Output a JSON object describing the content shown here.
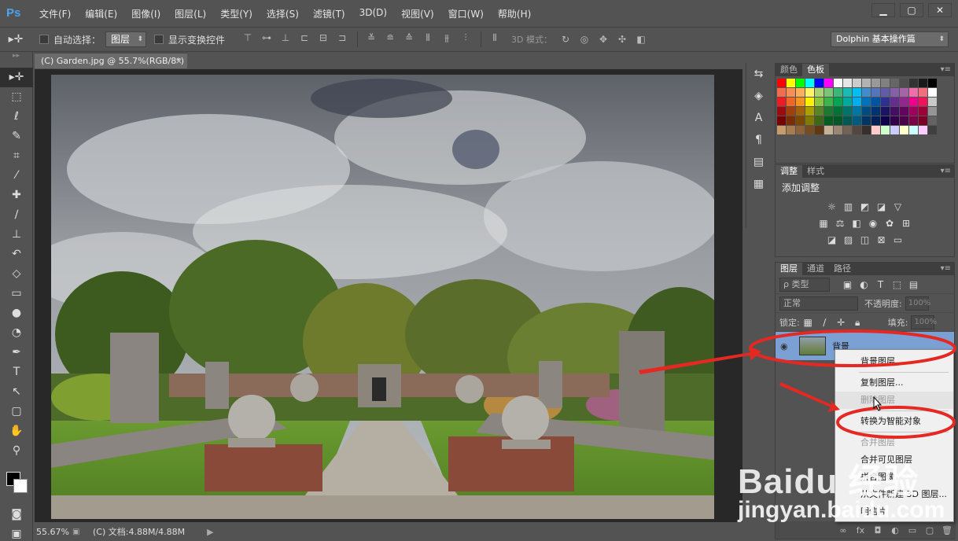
{
  "app": {
    "logo": "Ps"
  },
  "menu": [
    "文件(F)",
    "编辑(E)",
    "图像(I)",
    "图层(L)",
    "类型(Y)",
    "选择(S)",
    "滤镜(T)",
    "3D(D)",
    "视图(V)",
    "窗口(W)",
    "帮助(H)"
  ],
  "window_controls": {
    "minimize": "▁",
    "restore": "▢",
    "close": "✕"
  },
  "options": {
    "auto_select_label": "自动选择：",
    "auto_select_value": "图层",
    "show_transform_label": "显示变换控件",
    "mode3d_label": "3D 模式：",
    "workspace": "Dolphin 基本操作篇"
  },
  "document": {
    "tab_title": "(C) Garden.jpg @ 55.7%(RGB/8*)",
    "tab_close": "×"
  },
  "status": {
    "zoom": "55.67%",
    "doc": "(C) 文档:4.88M/4.88M",
    "arrow": "▶"
  },
  "panels": {
    "color_tabs": [
      "颜色",
      "色板"
    ],
    "adjust_tabs": [
      "调整",
      "样式"
    ],
    "add_adjustment": "添加调整",
    "layers_tabs": [
      "图层",
      "通道",
      "路径"
    ],
    "filter_kind": "ρ 类型",
    "blend_mode": "正常",
    "opacity_label": "不透明度:",
    "opacity_value": "100%",
    "lock_label": "锁定:",
    "fill_label": "填充:",
    "fill_value": "100%",
    "layer_name": "背景",
    "menu_glyph": "▾≡"
  },
  "context_menu": [
    {
      "label": "背景图层...",
      "disabled": false
    },
    {
      "label": "复制图层...",
      "disabled": false
    },
    {
      "label": "删除图层",
      "disabled": true,
      "hover": true
    },
    {
      "label": "转换为智能对象",
      "disabled": false
    },
    {
      "label": "合并图层",
      "disabled": true
    },
    {
      "label": "合并可见图层",
      "disabled": false
    },
    {
      "label": "拼合图像",
      "disabled": false
    },
    {
      "label": "从文件新建 3D 图层...",
      "disabled": false
    },
    {
      "label": "明信片",
      "disabled": false
    }
  ],
  "watermark": {
    "brand": "Baidu 经验",
    "url": "jingyan.baidu.com"
  },
  "colors": {
    "accent_red": "#e52822",
    "selection_blue": "#7aa0d4",
    "ps_blue": "#4aa3f0"
  },
  "swatches": [
    "#ff0000",
    "#ffff00",
    "#00ff00",
    "#00ffff",
    "#0000ff",
    "#ff00ff",
    "#ffffff",
    "#e6e6e6",
    "#cccccc",
    "#b3b3b3",
    "#999999",
    "#808080",
    "#666666",
    "#4d4d4d",
    "#333333",
    "#1a1a1a",
    "#000000",
    "#f26c4f",
    "#f68e55",
    "#fbaf5c",
    "#fff467",
    "#acd372",
    "#7cc576",
    "#3bb878",
    "#1abbb4",
    "#00bff3",
    "#438ccb",
    "#5574b9",
    "#605ca8",
    "#855fa8",
    "#a763a8",
    "#f06ea9",
    "#f26d7d",
    "#ffffff",
    "#ed1c24",
    "#f26522",
    "#f7941d",
    "#fff200",
    "#8dc63f",
    "#39b54a",
    "#00a651",
    "#00a99d",
    "#00aeef",
    "#0072bc",
    "#0054a6",
    "#2e3192",
    "#662d91",
    "#92278f",
    "#ec008c",
    "#ed145b",
    "#c8c8c8",
    "#9e0b0f",
    "#a0410d",
    "#a36209",
    "#aba000",
    "#598527",
    "#1a7b30",
    "#007236",
    "#00746b",
    "#0076a3",
    "#004b80",
    "#003471",
    "#1b1464",
    "#440e62",
    "#630460",
    "#9e005d",
    "#9e0039",
    "#959595",
    "#790000",
    "#7b2e00",
    "#7d4900",
    "#827b00",
    "#406618",
    "#005e20",
    "#005826",
    "#005952",
    "#005b7f",
    "#003663",
    "#002157",
    "#0d004c",
    "#32004b",
    "#4b0049",
    "#7b0046",
    "#7a0026",
    "#636363",
    "#c69c6d",
    "#a67c52",
    "#8c6239",
    "#754c24",
    "#603813",
    "#c7b299",
    "#998675",
    "#736357",
    "#534741",
    "#362f2d",
    "#ffcccc",
    "#ccffcc",
    "#ccccff",
    "#ffffcc",
    "#ccffff",
    "#ffccff",
    "#404040"
  ]
}
